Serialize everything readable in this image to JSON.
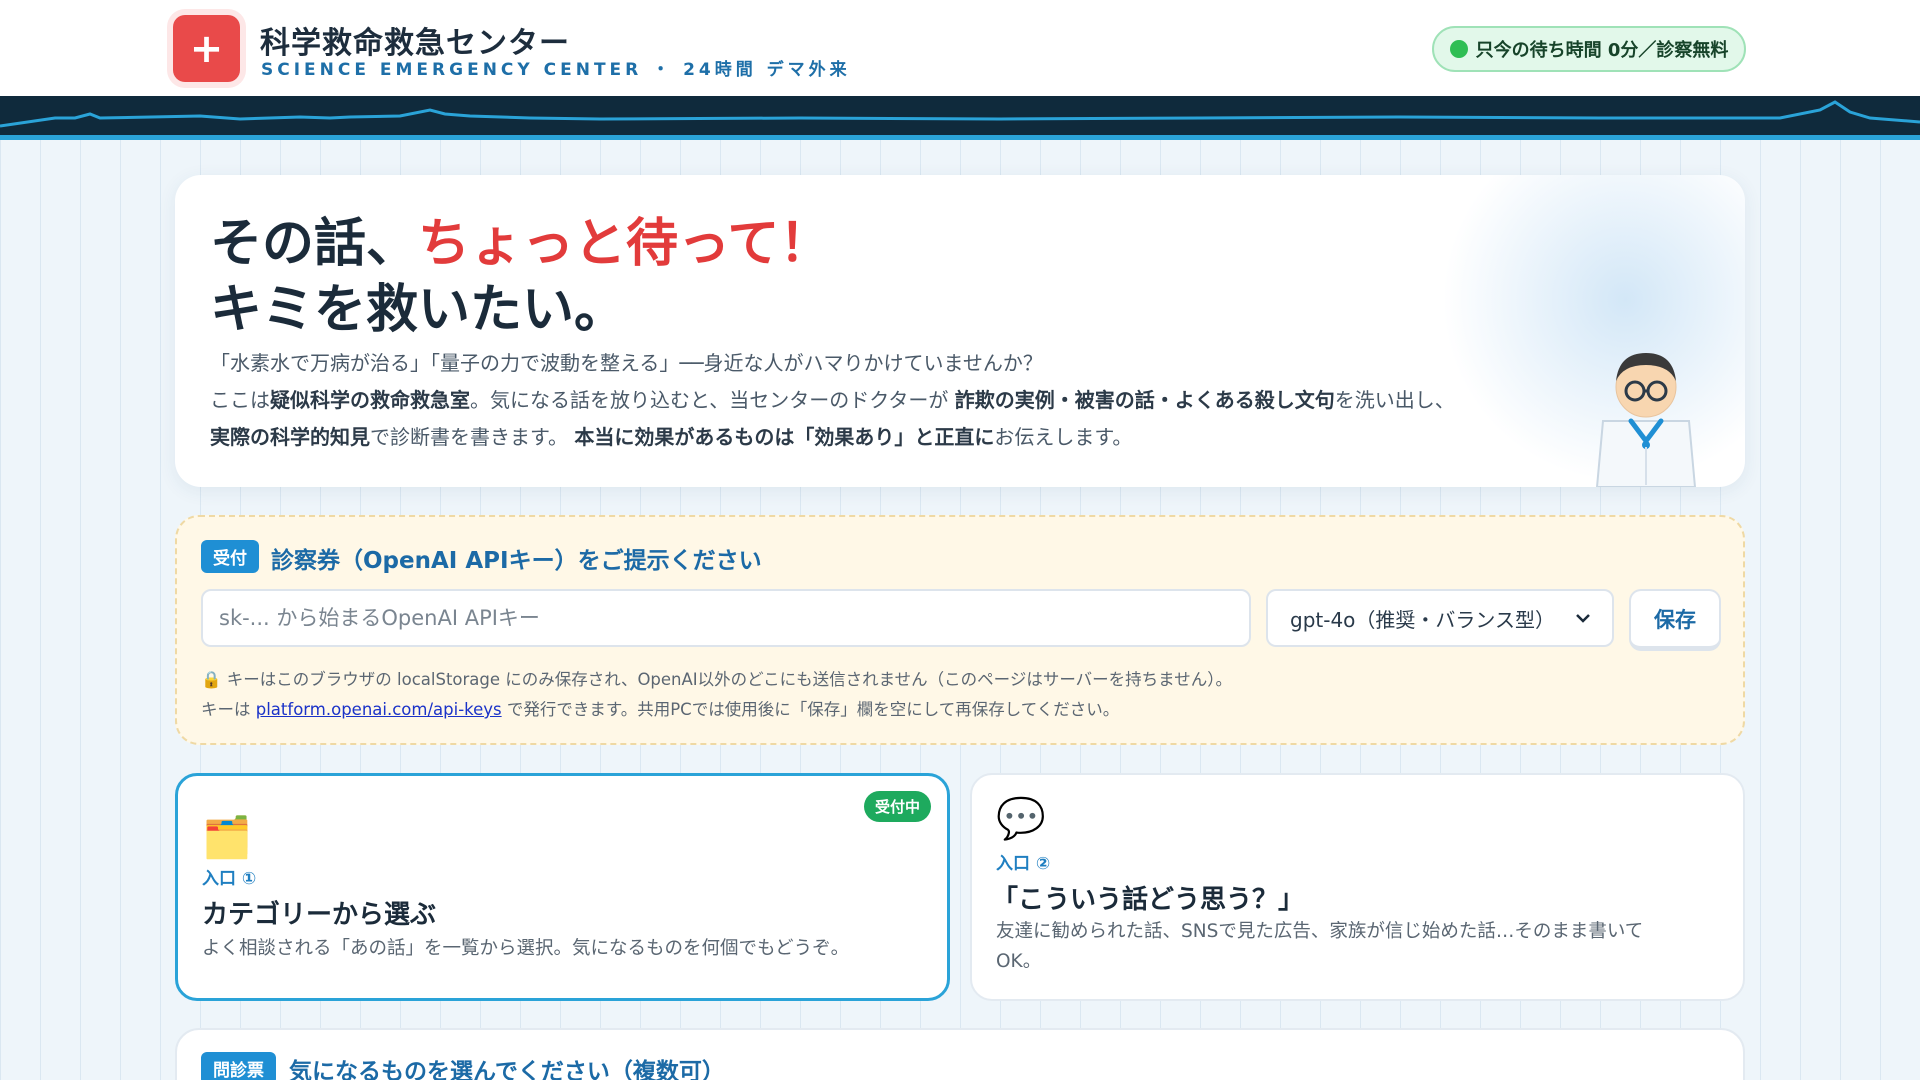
{
  "header": {
    "logo_symbol": "+",
    "title": "科学救命救急センター",
    "subtitle": "SCIENCE EMERGENCY CENTER ・ 24時間 デマ外来",
    "wait_badge": "只今の待ち時間 0分／診察無料"
  },
  "hero": {
    "heading_line1_a": "その話、",
    "heading_line1_b": "ちょっと待って！",
    "heading_line2": "キミを救いたい。",
    "para1": "「水素水で万病が治る」「量子の力で波動を整える」──身近な人がハマりかけていませんか？",
    "para2_a": "ここは",
    "para2_b": "疑似科学の救命救急室",
    "para2_c": "。気になる話を放り込むと、当センターのドクターが",
    "para2_d": "詐欺の実例・被害の話・よくある殺し文句",
    "para2_e": "を洗い出し、",
    "para3_a": "実際の科学的知見",
    "para3_b": "で診断書を書きます。",
    "para3_c": "本当に効果があるものは「効果あり」と正直に",
    "para3_d": "お伝えします。"
  },
  "api": {
    "tag": "受付",
    "title": "診察券（OpenAI APIキー）をご提示ください",
    "input_placeholder": "sk-... から始まるOpenAI APIキー",
    "input_value": "",
    "model_selected": "gpt-4o（推奨・バランス型）",
    "save_label": "保存",
    "note1": "🔒 キーはこのブラウザの localStorage にのみ保存され、OpenAI以外のどこにも送信されません（このページはサーバーを持ちません）。",
    "note2_a": "キーは",
    "note2_link": "platform.openai.com/api-keys",
    "note2_b": "で発行できます。共用PCでは使用後に「保存」欄を空にして再保存してください。"
  },
  "entries": [
    {
      "icon": "🗂️",
      "label": "入口 ①",
      "title": "カテゴリーから選ぶ",
      "desc": "よく相談される「あの話」を一覧から選択。気になるものを何個でもどうぞ。",
      "badge": "受付中",
      "active": true
    },
    {
      "icon": "💬",
      "label": "入口 ②",
      "title": "「こういう話どう思う？」",
      "desc_line1": "友達に勧められた話、SNSで見た広告、家族が信じ始めた話…そのまま書いて",
      "desc_line2": "OK。",
      "active": false
    }
  ],
  "bottom": {
    "tag": "問診票",
    "title": "気になるものを選んでください（複数可）"
  },
  "colors": {
    "accent_blue": "#1f8fd4",
    "accent_red": "#e23b3b",
    "ecg_band": "#0f2a3c",
    "ecg_line": "#2aa3d8",
    "wait_green": "#2fbe54"
  }
}
